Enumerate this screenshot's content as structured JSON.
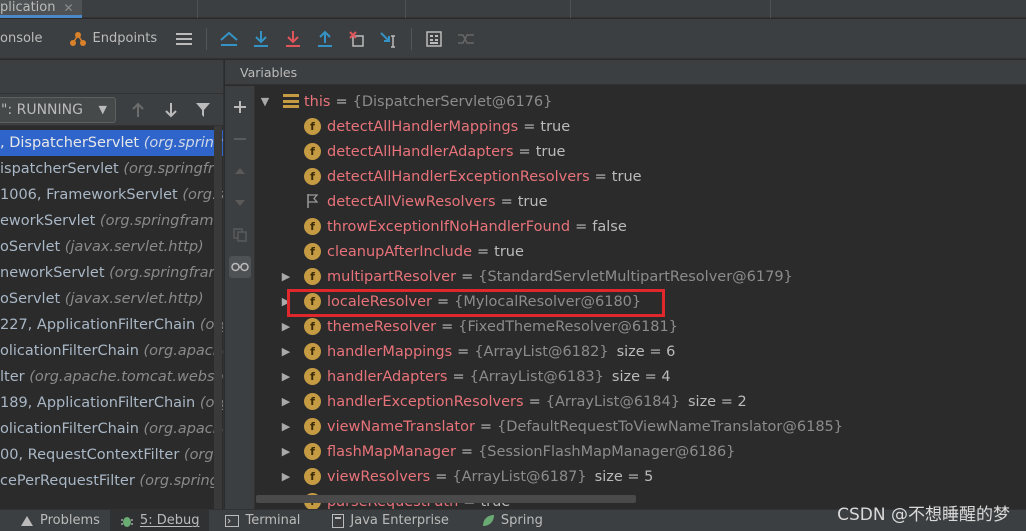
{
  "tab": {
    "title": "plication"
  },
  "toolbar": {
    "console": "onsole",
    "endpoints": "Endpoints"
  },
  "thread": {
    "selected": "\": RUNNING"
  },
  "frames": [
    {
      "text": ", DispatcherServlet ",
      "cls": "(org.spring",
      "selected": true
    },
    {
      "text": "ispatcherServlet ",
      "cls": "(org.springfra",
      "selected": false
    },
    {
      "text": "1006, FrameworkServlet ",
      "cls": "(org.s",
      "selected": false
    },
    {
      "text": "eworkServlet ",
      "cls": "(org.springframe",
      "selected": false
    },
    {
      "text": "oServlet ",
      "cls": "(javax.servlet.http)",
      "selected": false
    },
    {
      "text": "neworkServlet ",
      "cls": "(org.springframe",
      "selected": false
    },
    {
      "text": "oServlet ",
      "cls": "(javax.servlet.http)",
      "selected": false
    },
    {
      "text": "227, ApplicationFilterChain ",
      "cls": "(org",
      "selected": false
    },
    {
      "text": "olicationFilterChain ",
      "cls": "(org.apache",
      "selected": false
    },
    {
      "text": "lter ",
      "cls": "(org.apache.tomcat.webso",
      "selected": false
    },
    {
      "text": "189, ApplicationFilterChain ",
      "cls": "(org",
      "selected": false
    },
    {
      "text": "olicationFilterChain ",
      "cls": "(org.apache",
      "selected": false
    },
    {
      "text": "00, RequestContextFilter ",
      "cls": "(org.",
      "selected": false
    },
    {
      "text": "cePerRequestFilter ",
      "cls": "(org.spring",
      "selected": false
    }
  ],
  "variables": {
    "header": "Variables",
    "this_row": {
      "name": "this",
      "eq": "=",
      "value": "{DispatcherServlet@6176}"
    },
    "rows": [
      {
        "name": "detectAllHandlerMappings",
        "value": "true",
        "expandable": false,
        "icon": "field"
      },
      {
        "name": "detectAllHandlerAdapters",
        "value": "true",
        "expandable": false,
        "icon": "field"
      },
      {
        "name": "detectAllHandlerExceptionResolvers",
        "value": "true",
        "expandable": false,
        "icon": "field"
      },
      {
        "name": "detectAllViewResolvers",
        "value": "true",
        "expandable": false,
        "icon": "flag"
      },
      {
        "name": "throwExceptionIfNoHandlerFound",
        "value": "false",
        "expandable": false,
        "icon": "field"
      },
      {
        "name": "cleanupAfterInclude",
        "value": "true",
        "expandable": false,
        "icon": "field"
      },
      {
        "name": "multipartResolver",
        "ref": "{StandardServletMultipartResolver@6179}",
        "expandable": true,
        "icon": "field"
      },
      {
        "name": "localeResolver",
        "ref": "{MylocalResolver@6180}",
        "expandable": true,
        "icon": "field"
      },
      {
        "name": "themeResolver",
        "ref": "{FixedThemeResolver@6181}",
        "expandable": true,
        "icon": "field"
      },
      {
        "name": "handlerMappings",
        "ref": "{ArrayList@6182}",
        "size": "size = 6",
        "expandable": true,
        "icon": "field"
      },
      {
        "name": "handlerAdapters",
        "ref": "{ArrayList@6183}",
        "size": "size = 4",
        "expandable": true,
        "icon": "field"
      },
      {
        "name": "handlerExceptionResolvers",
        "ref": "{ArrayList@6184}",
        "size": "size = 2",
        "expandable": true,
        "icon": "field"
      },
      {
        "name": "viewNameTranslator",
        "ref": "{DefaultRequestToViewNameTranslator@6185}",
        "expandable": true,
        "icon": "field"
      },
      {
        "name": "flashMapManager",
        "ref": "{SessionFlashMapManager@6186}",
        "expandable": true,
        "icon": "field"
      },
      {
        "name": "viewResolvers",
        "ref": "{ArrayList@6187}",
        "size": "size = 5",
        "expandable": true,
        "icon": "field"
      },
      {
        "name": "parseRequestPath",
        "value": "true",
        "expandable": false,
        "icon": "field"
      }
    ]
  },
  "statusbar": {
    "problems": "Problems",
    "debug": "5: Debug",
    "terminal": "Terminal",
    "java_enterprise": "Java Enterprise",
    "spring": "Spring"
  },
  "watermark": "CSDN @不想睡醒的梦",
  "colors": {
    "accent": "#2f65ca",
    "field_icon": "#c49b42",
    "highlight": "#e0272b",
    "name": "#e8737a"
  }
}
